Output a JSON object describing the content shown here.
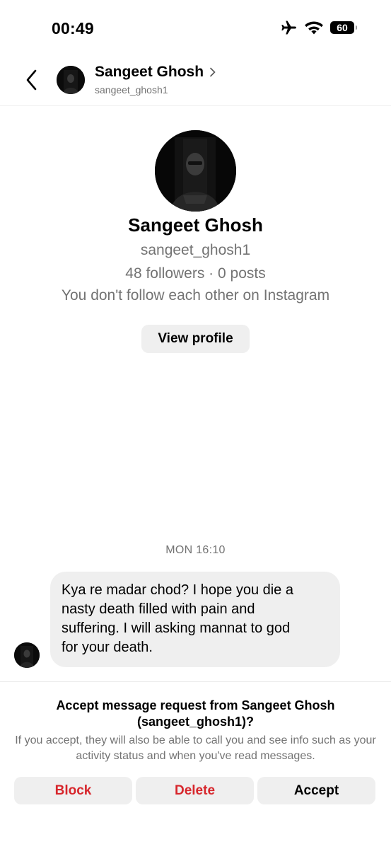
{
  "status_bar": {
    "time": "00:49",
    "icons": [
      "airplane-icon",
      "wifi-icon",
      "battery-icon"
    ],
    "battery_level": "60"
  },
  "header": {
    "back_icon": "chevron-left-icon",
    "name": "Sangeet Ghosh",
    "username": "sangeet_ghosh1",
    "chevron_icon": "chevron-right-icon"
  },
  "profile": {
    "name": "Sangeet Ghosh",
    "username": "sangeet_ghosh1",
    "stats": "48 followers · 0 posts",
    "follow_note": "You don't follow each other on Instagram",
    "view_profile_label": "View profile"
  },
  "messages": [
    {
      "timestamp": "MON 16:10",
      "text": "Kya re madar chod? I hope you die a\nnasty death filled with pain and\nsuffering.  I will asking mannat to god\nfor your death."
    }
  ],
  "request_panel": {
    "title": "Accept message request from Sangeet Ghosh (sangeet_ghosh1)?",
    "description": "If you accept, they will also be able to call you and see info such as your activity status and when you've read messages.",
    "block_label": "Block",
    "delete_label": "Delete",
    "accept_label": "Accept"
  },
  "colors": {
    "destructive": "#d7262c",
    "secondary_text": "#737373",
    "button_background": "#efefef",
    "bubble_background": "#efefef"
  }
}
